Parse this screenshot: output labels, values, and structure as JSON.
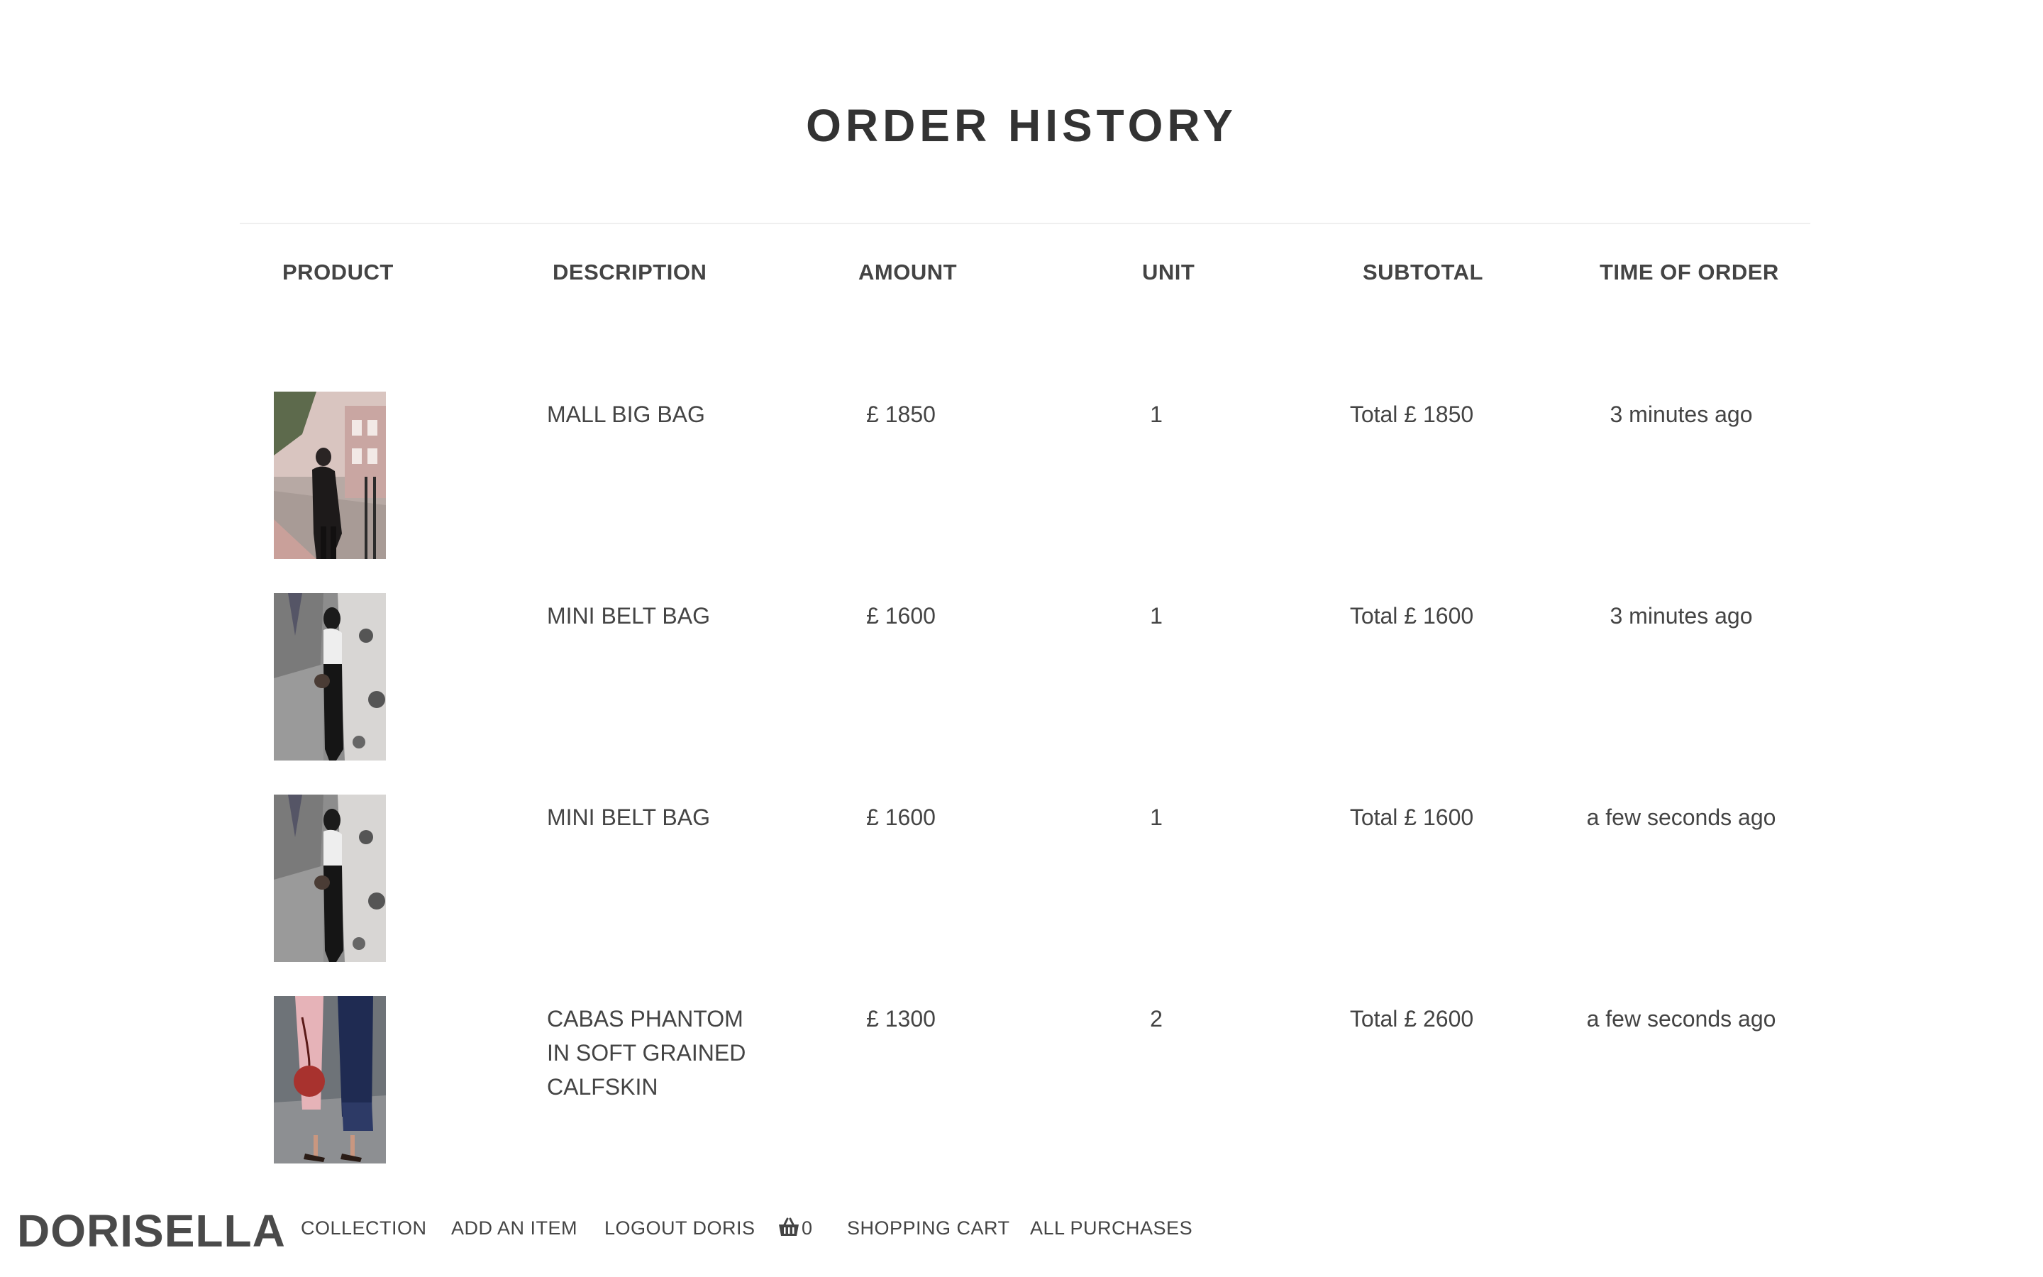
{
  "page": {
    "title": "ORDER HISTORY"
  },
  "table": {
    "headers": {
      "product": "PRODUCT",
      "description": "DESCRIPTION",
      "amount": "AMOUNT",
      "unit": "UNIT",
      "subtotal": "SUBTOTAL",
      "time": "TIME OF ORDER"
    },
    "rows": [
      {
        "image_icon": "woman-black-coat-photo",
        "description": "MALL BIG BAG",
        "amount": "£ 1850",
        "unit": "1",
        "subtotal": "Total £ 1850",
        "time": "3 minutes ago"
      },
      {
        "image_icon": "woman-street-wall-photo",
        "description": "MINI BELT BAG",
        "amount": "£ 1600",
        "unit": "1",
        "subtotal": "Total £ 1600",
        "time": "3 minutes ago"
      },
      {
        "image_icon": "woman-street-wall-photo",
        "description": "MINI BELT BAG",
        "amount": "£ 1600",
        "unit": "1",
        "subtotal": "Total £ 1600",
        "time": "a few seconds ago"
      },
      {
        "image_icon": "red-round-bag-photo",
        "description": "CABAS PHANTOM IN SOFT GRAINED CALFSKIN",
        "amount": "£ 1300",
        "unit": "2",
        "subtotal": "Total £ 2600",
        "time": "a few seconds ago"
      }
    ]
  },
  "navbar": {
    "brand": "DORISELLA",
    "items": {
      "collection": "COLLECTION",
      "add_item": "ADD AN ITEM",
      "logout": "LOGOUT DORIS",
      "cart_count": "0",
      "shopping_cart": "SHOPPING CART",
      "all_purchases": "ALL PURCHASES"
    },
    "cart_icon": "basket-icon"
  },
  "colors": {
    "text": "#444444",
    "title": "#333333",
    "divider": "#efefef",
    "background": "#ffffff"
  }
}
